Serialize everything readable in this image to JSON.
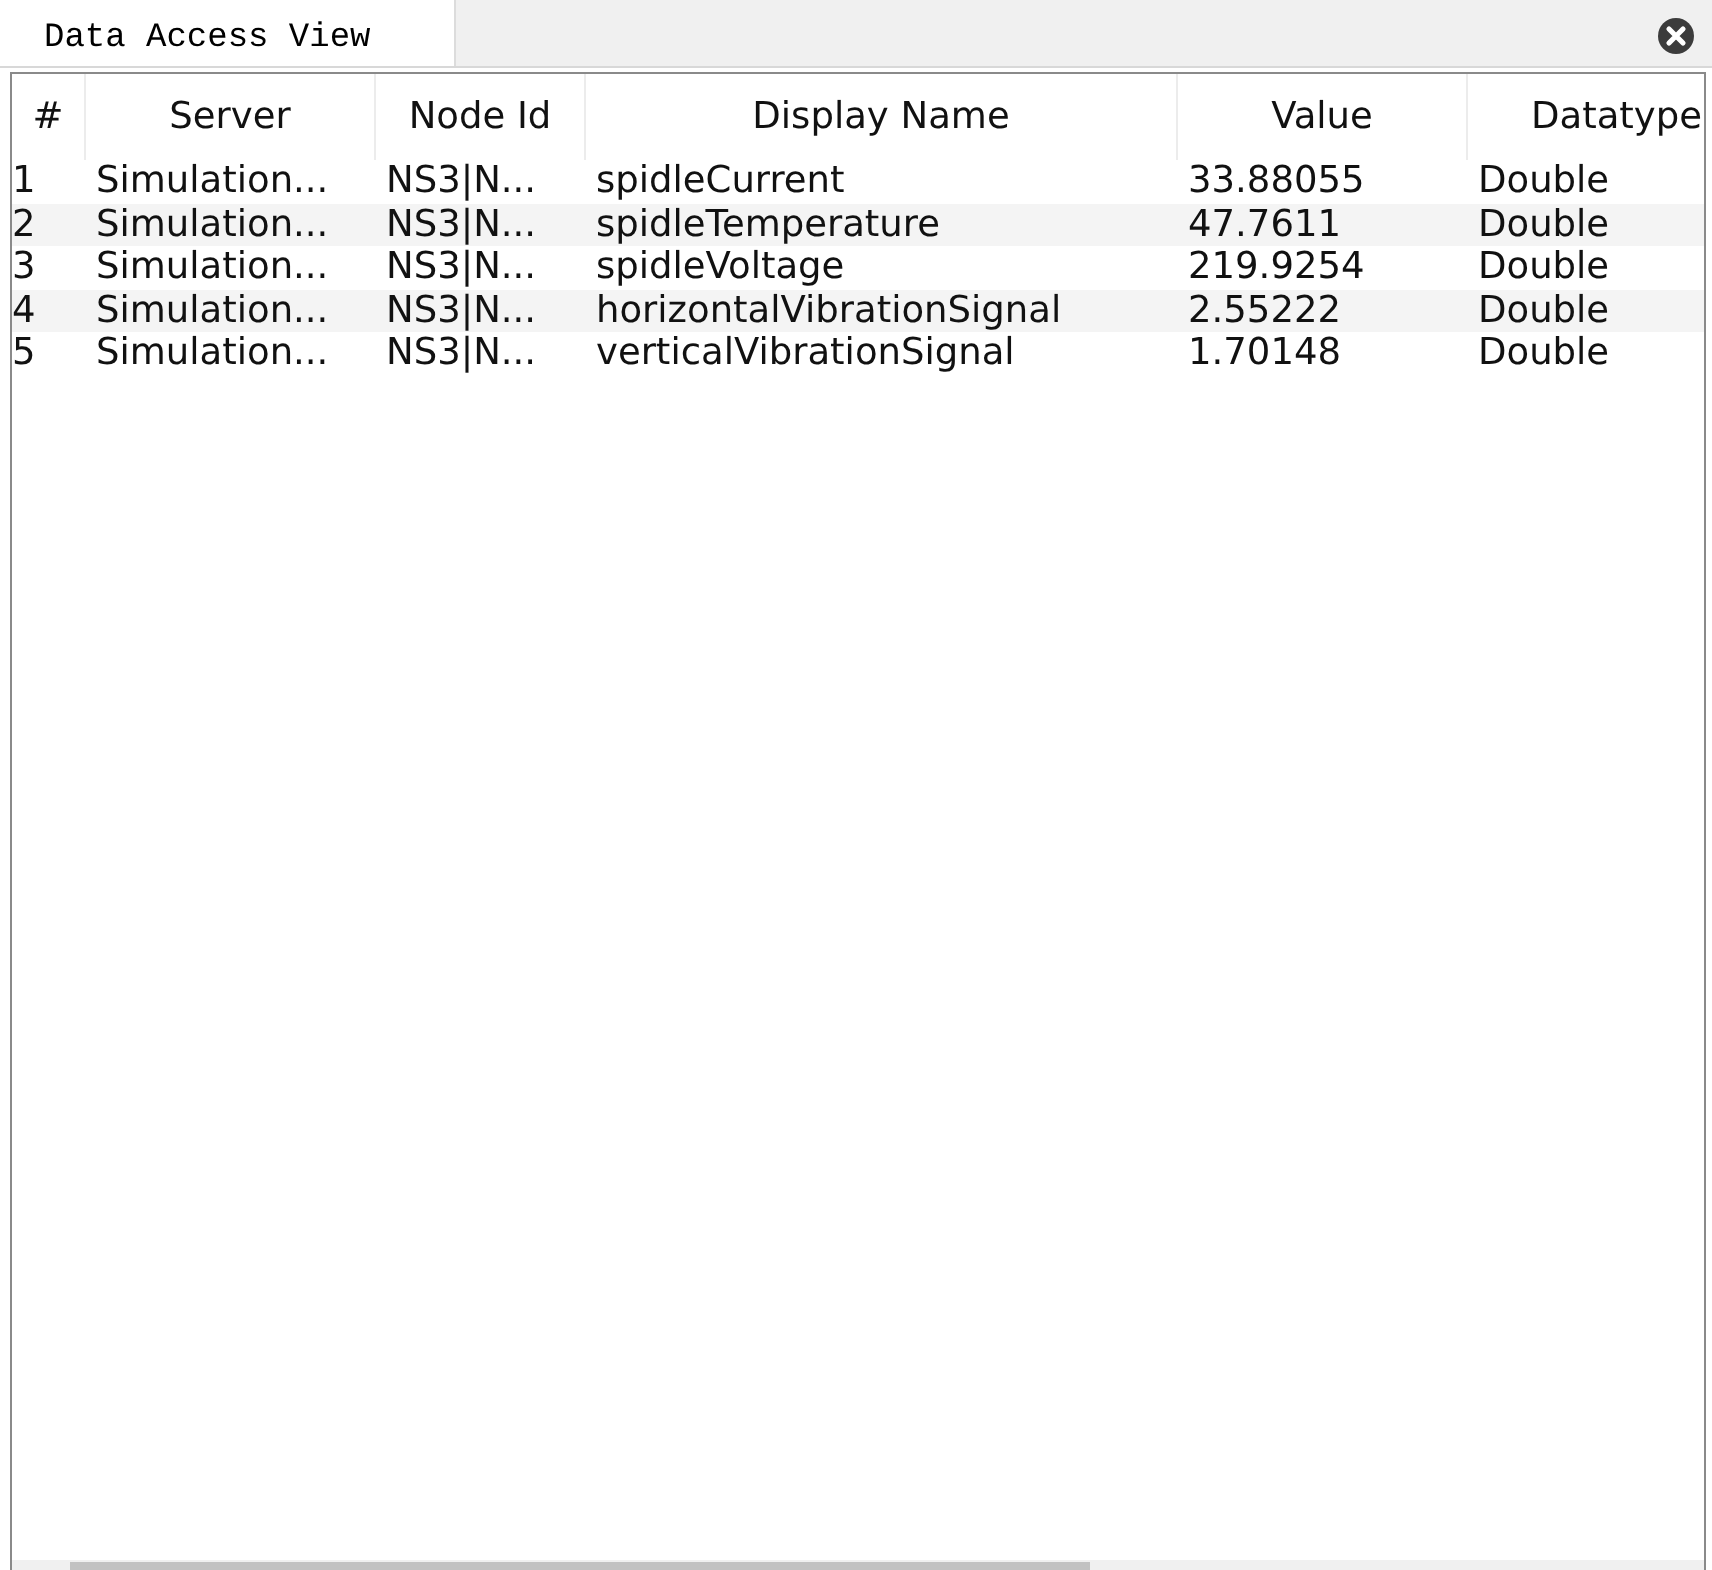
{
  "tabs": [
    {
      "label": "Data Access View",
      "selected": true
    }
  ],
  "table": {
    "columns": [
      "#",
      "Server",
      "Node Id",
      "Display Name",
      "Value",
      "Datatype"
    ],
    "rows": [
      [
        "1",
        "Simulation...",
        "NS3|N...",
        "spidleCurrent",
        "33.88055",
        "Double"
      ],
      [
        "2",
        "Simulation...",
        "NS3|N...",
        "spidleTemperature",
        "47.7611",
        "Double"
      ],
      [
        "3",
        "Simulation...",
        "NS3|N...",
        "spidleVoltage",
        "219.9254",
        "Double"
      ],
      [
        "4",
        "Simulation...",
        "NS3|N...",
        "horizontalVibrationSignal",
        "2.55222",
        "Double"
      ],
      [
        "5",
        "Simulation...",
        "NS3|N...",
        "verticalVibrationSignal",
        "1.70148",
        "Double"
      ]
    ]
  }
}
